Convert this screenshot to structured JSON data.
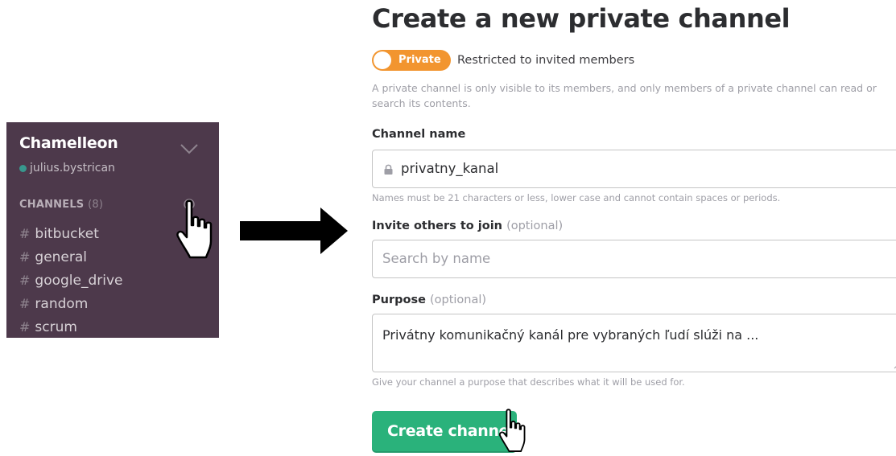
{
  "sidebar": {
    "team_name": "Chamelleon",
    "username": "julius.bystrican",
    "channels_header": "CHANNELS",
    "channels_count": "(8)",
    "channels": [
      {
        "label": "bitbucket"
      },
      {
        "label": "general"
      },
      {
        "label": "google_drive"
      },
      {
        "label": "random"
      },
      {
        "label": "scrum"
      }
    ],
    "hash_symbol": "#",
    "background_color": "#4d394b",
    "presence_color": "#38978d"
  },
  "modal": {
    "title": "Create a new private channel",
    "toggle_label": "Private",
    "toggle_description": "Restricted to invited members",
    "private_help": "A private channel is only visible to its members, and only members of a private channel can read or search its contents.",
    "channel_name": {
      "label": "Channel name",
      "value": "privatny_kanal",
      "hint": "Names must be 21 characters or less, lower case and cannot contain spaces or periods."
    },
    "invite": {
      "label": "Invite others to join",
      "optional": "(optional)",
      "placeholder": "Search by name"
    },
    "purpose": {
      "label": "Purpose",
      "optional": "(optional)",
      "value": "Privátny komunikačný kanál pre vybraných ľudí slúži na ...",
      "hint": "Give your channel a purpose that describes what it will be used for."
    },
    "create_button": "Create channel",
    "accent_color": "#f2952f",
    "button_color": "#2ab27b"
  },
  "icons": [
    "chevron-down-icon",
    "add-circle-icon",
    "lock-icon",
    "hand-pointer-icon",
    "right-arrow-icon",
    "resize-handle-icon"
  ]
}
